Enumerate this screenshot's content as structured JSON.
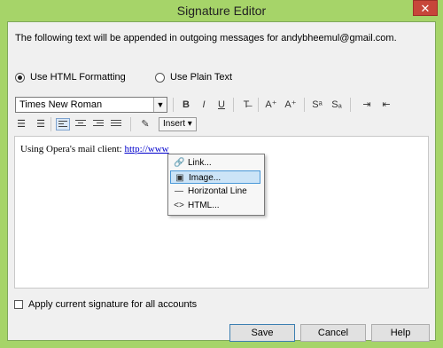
{
  "window": {
    "title": "Signature Editor",
    "close_glyph": "✕"
  },
  "description": "The following text will be appended in outgoing messages for andybheemul@gmail.com.",
  "format": {
    "html_label": "Use HTML Formatting",
    "plain_label": "Use Plain Text",
    "selected": "html"
  },
  "toolbar": {
    "font_name": "Times New Roman",
    "bold": "B",
    "italic": "I",
    "underline": "U",
    "strike": "T̶",
    "grow": "A⁺",
    "shrink": "A⁺",
    "superscript": "Sᵃ",
    "subscript": "Sₐ",
    "insert_label": "Insert ▾"
  },
  "editor": {
    "text_prefix": "Using Opera's mail client: ",
    "link_text": "http://www"
  },
  "insert_menu": {
    "items": [
      {
        "label": "Link...",
        "icon": "link-icon"
      },
      {
        "label": "Image...",
        "icon": "image-icon"
      },
      {
        "label": "Horizontal Line",
        "icon": "horizontal-line-icon"
      },
      {
        "label": "HTML...",
        "icon": "code-icon"
      }
    ],
    "highlighted": "Image..."
  },
  "apply_all": {
    "label": "Apply current signature for all accounts",
    "checked": false
  },
  "buttons": {
    "save": "Save",
    "cancel": "Cancel",
    "help": "Help"
  },
  "colors": {
    "frame": "#a6d469",
    "close": "#c7463a",
    "menu_highlight": "#cce4f7",
    "link": "#0000cc"
  }
}
